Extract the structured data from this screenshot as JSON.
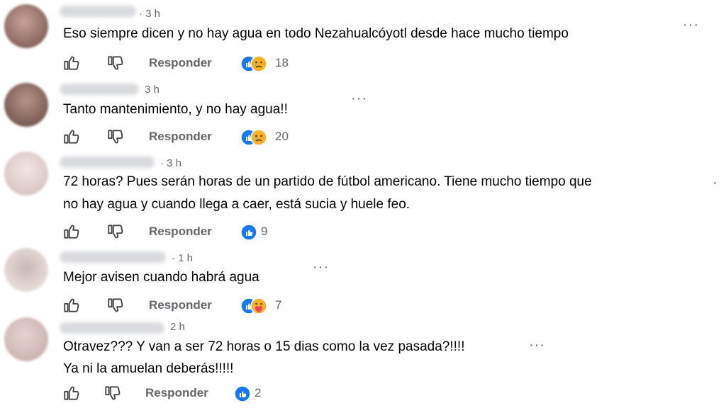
{
  "comments": [
    {
      "time": "· 3 h",
      "lines": [
        "Eso siempre dicen y no hay agua en todo Nezahualcóyotl desde hace mucho tiempo"
      ],
      "reply": "Responder",
      "reactions": [
        "like-icon",
        "sad-icon"
      ],
      "count": "18"
    },
    {
      "time": "3 h",
      "lines": [
        "Tanto mantenimiento, y no hay agua!!"
      ],
      "reply": "Responder",
      "reactions": [
        "like-icon",
        "sad-icon"
      ],
      "count": "20"
    },
    {
      "time": "· 3 h",
      "lines": [
        "72 horas? Pues serán horas de un partido de fútbol americano. Tiene mucho tiempo que",
        "no hay agua y cuando llega a caer, está sucia y huele feo."
      ],
      "reply": "Responder",
      "reactions": [
        "like-icon"
      ],
      "count": "9"
    },
    {
      "time": "· 1 h",
      "lines": [
        "Mejor avisen cuando habrá agua"
      ],
      "reply": "Responder",
      "reactions": [
        "like-icon",
        "care-icon"
      ],
      "count": "7"
    },
    {
      "time": "2 h",
      "lines": [
        "Otravez??? Y van a ser 72 horas o 15 dias como la vez pasada?!!!!",
        "Ya ni la amuelan deberás!!!!!"
      ],
      "reply": "Responder",
      "reactions": [
        "like-icon"
      ],
      "count": "2"
    }
  ],
  "colors": {
    "like_blue": "#1877f2",
    "secondary_text": "#65676b",
    "emoji_yellow": "#f7b125"
  }
}
